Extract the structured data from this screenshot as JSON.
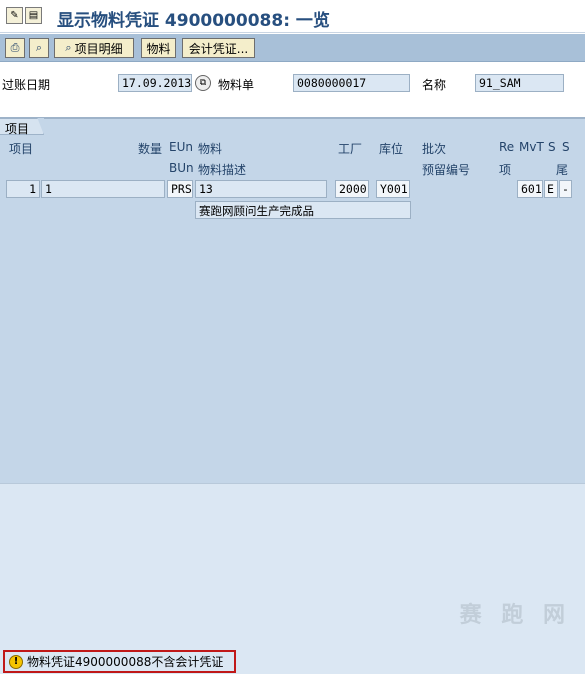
{
  "window": {
    "title": "显示物料凭证 4900000088: 一览"
  },
  "toolbar": {
    "item_detail": "项目明细",
    "material": "物料",
    "accounting_doc": "会计凭证..."
  },
  "header": {
    "posting_date_label": "过账日期",
    "posting_date": "17.09.2013",
    "material_slip_label": "物料单",
    "material_slip": "0080000017",
    "name_label": "名称",
    "name": "91_SAM"
  },
  "items_tab": {
    "label": "项目",
    "columns_row1": {
      "item": "项目",
      "quantity": "数量",
      "eun": "EUn",
      "material": "物料",
      "plant": "工厂",
      "storage_loc": "库位",
      "batch": "批次",
      "re": "Re",
      "mvt": "MvT",
      "s1": "S",
      "s2": "S"
    },
    "columns_row2": {
      "bun": "BUn",
      "material_desc": "物料描述",
      "reservation": "预留编号",
      "item2": "项",
      "tail": "尾"
    },
    "rows": [
      {
        "item": "1",
        "quantity": "1",
        "eun": "PRS",
        "material": "13",
        "plant": "2000",
        "storage_loc": "Y001",
        "mvt": "601",
        "s1": "E",
        "s2": "-",
        "description": "赛跑网顾问生产完成品"
      }
    ]
  },
  "status": {
    "message": "物料凭证4900000088不含会计凭证"
  },
  "watermark": "赛 跑 网"
}
